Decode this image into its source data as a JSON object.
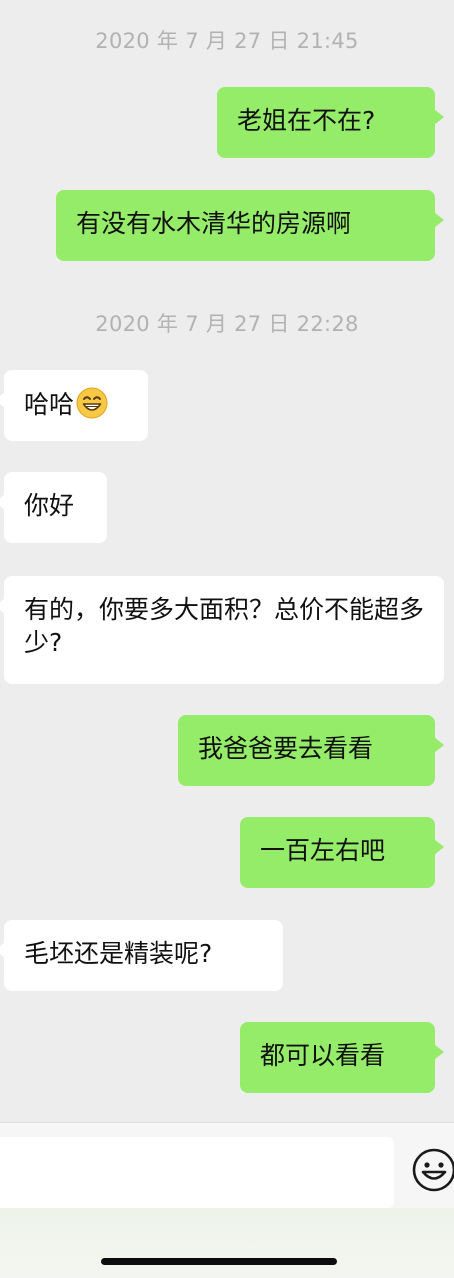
{
  "chat": {
    "timestamp_1": "2020 年 7 月 27 日  21:45",
    "timestamp_2": "2020 年 7 月 27 日  22:28",
    "messages": [
      {
        "direction": "out",
        "text": "老姐在不在?"
      },
      {
        "direction": "out",
        "text": "有没有水木清华的房源啊"
      },
      {
        "direction": "in",
        "text": "哈哈",
        "emoji": "grinning-face-emoji"
      },
      {
        "direction": "in",
        "text": "你好"
      },
      {
        "direction": "in",
        "text": "有的，你要多大面积？总价不能超多少?"
      },
      {
        "direction": "out",
        "text": "我爸爸要去看看"
      },
      {
        "direction": "out",
        "text": "一百左右吧"
      },
      {
        "direction": "in",
        "text": "毛坯还是精装呢?"
      },
      {
        "direction": "out",
        "text": "都可以看看"
      }
    ]
  },
  "input_bar": {
    "value": "",
    "emoji_button_icon": "smiley-face-icon"
  },
  "colors": {
    "background": "#ededed",
    "outgoing_bubble": "#95ec69",
    "incoming_bubble": "#ffffff",
    "timestamp_text": "#b2b2b2"
  }
}
